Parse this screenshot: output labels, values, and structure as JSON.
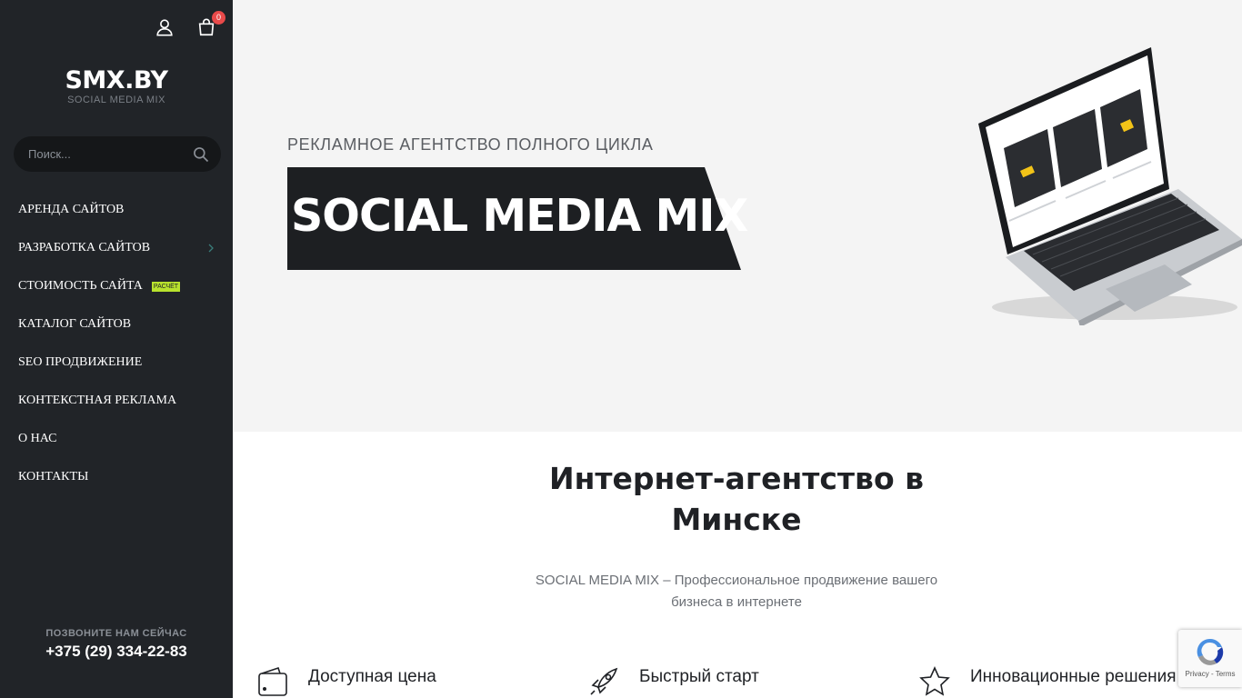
{
  "sidebar": {
    "logo_main": "SMX.BY",
    "logo_sub": "SOCIAL MEDIA MIX",
    "cart_count": "0",
    "search_placeholder": "Поиск...",
    "nav": [
      {
        "label": "АРЕНДА САЙТОВ"
      },
      {
        "label": "РАЗРАБОТКА САЙТОВ",
        "has_submenu": true
      },
      {
        "label": "СТОИМОСТЬ САЙТА",
        "badge": "РАСЧЁТ"
      },
      {
        "label": "КАТАЛОГ САЙТОВ"
      },
      {
        "label": "SEO ПРОДВИЖЕНИЕ"
      },
      {
        "label": "КОНТЕКСТНАЯ РЕКЛАМА"
      },
      {
        "label": "О НАС"
      },
      {
        "label": "КОНТАКТЫ"
      }
    ],
    "call_label": "ПОЗВОНИТЕ НАМ СЕЙЧАС",
    "call_phone": "+375 (29) 334-22-83"
  },
  "hero": {
    "kicker": "РЕКЛАМНОЕ АГЕНТСТВО ПОЛНОГО ЦИКЛА",
    "title": "SOCIAL MEDIA MIX"
  },
  "content": {
    "title": "Интернет-агентство в Минске",
    "subtitle": "SOCIAL MEDIA MIX – Профессиональное продвижение вашего бизнеса в интернете",
    "features": [
      {
        "label": "Доступная цена",
        "icon": "wallet-icon"
      },
      {
        "label": "Быстрый старт",
        "icon": "rocket-icon"
      },
      {
        "label": "Инновационные решения",
        "icon": "star-icon"
      }
    ]
  },
  "recaptcha": {
    "links": "Privacy - Terms"
  },
  "colors": {
    "sidebar_bg": "#212428",
    "accent_badge": "#b8e22d",
    "cart_badge": "#e94a4a",
    "hero_bg": "#f4f4f4"
  }
}
